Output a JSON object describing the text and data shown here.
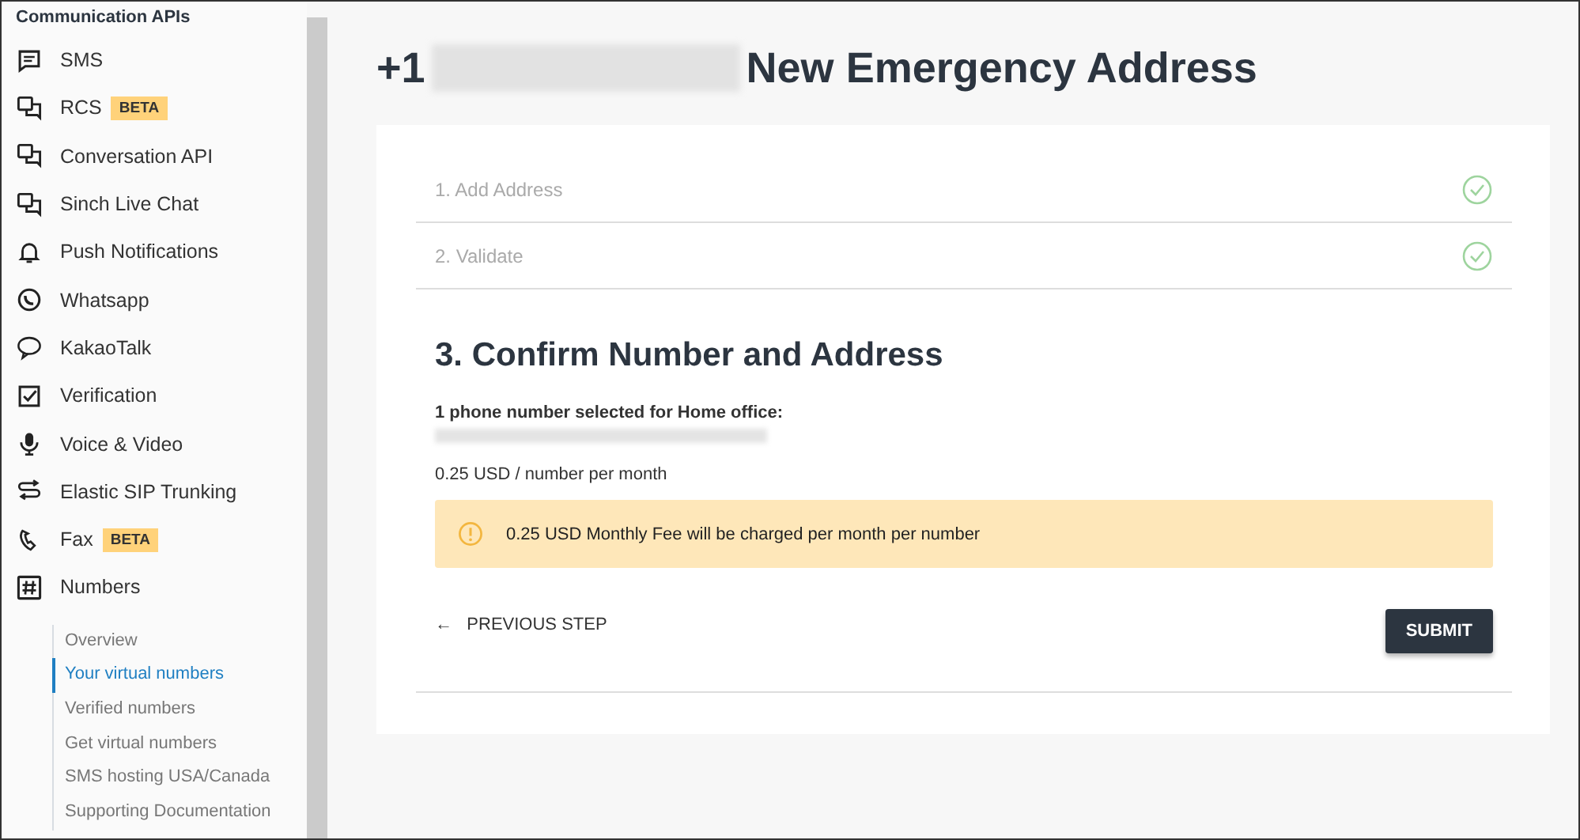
{
  "sidebar": {
    "heading": "Communication APIs",
    "items": [
      {
        "label": "SMS"
      },
      {
        "label": "RCS",
        "badge": "BETA"
      },
      {
        "label": "Conversation API"
      },
      {
        "label": "Sinch Live Chat"
      },
      {
        "label": "Push Notifications"
      },
      {
        "label": "Whatsapp"
      },
      {
        "label": "KakaoTalk"
      },
      {
        "label": "Verification"
      },
      {
        "label": "Voice & Video"
      },
      {
        "label": "Elastic SIP Trunking"
      },
      {
        "label": "Fax",
        "badge": "BETA"
      },
      {
        "label": "Numbers",
        "children": [
          {
            "label": "Overview",
            "selected": false
          },
          {
            "label": "Your virtual numbers",
            "selected": true
          },
          {
            "label": "Verified numbers",
            "selected": false
          },
          {
            "label": "Get virtual numbers",
            "selected": false
          },
          {
            "label": "SMS hosting USA/Canada",
            "selected": false
          },
          {
            "label": "Supporting Documentation",
            "selected": false
          }
        ]
      }
    ]
  },
  "page": {
    "title_prefix": "+1",
    "title": "New Emergency Address"
  },
  "steps": [
    {
      "label": "1. Add Address",
      "done": true
    },
    {
      "label": "2. Validate",
      "done": true
    }
  ],
  "current_step": {
    "title": "3. Confirm Number and Address",
    "selection": "1 phone number selected for Home office:",
    "price": "0.25 USD / number per month",
    "warning": "0.25 USD Monthly Fee will be charged per month per number",
    "back": "PREVIOUS STEP",
    "back_arrow": "←",
    "submit": "SUBMIT"
  }
}
